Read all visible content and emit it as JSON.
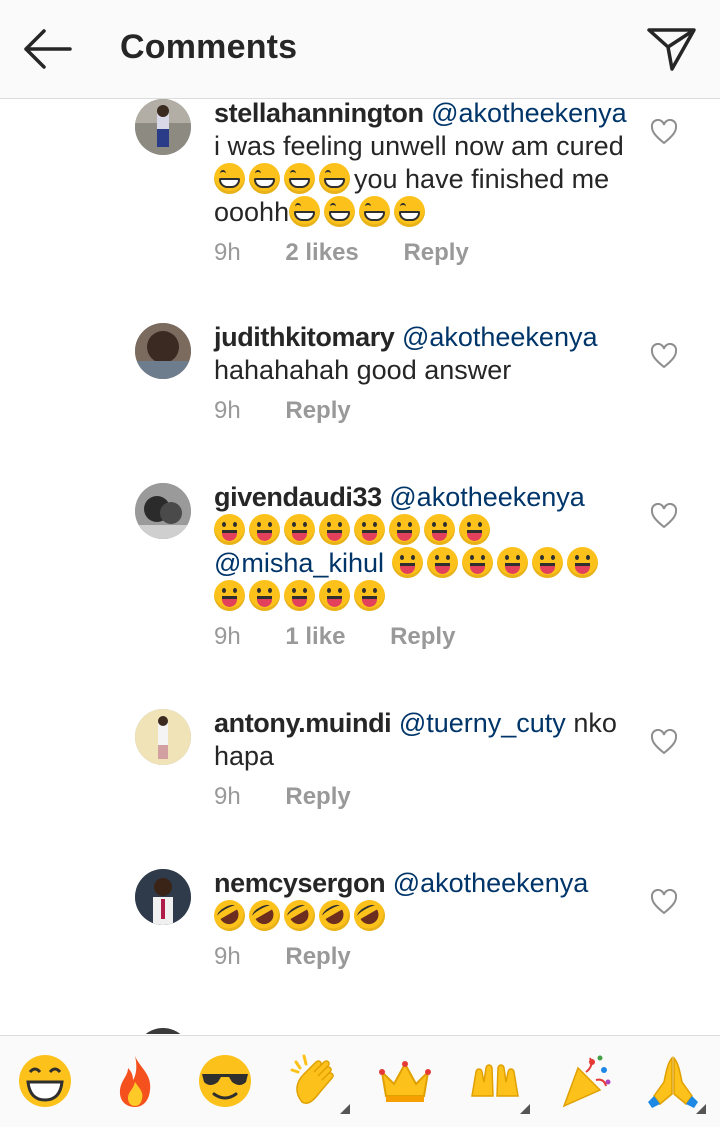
{
  "header": {
    "title": "Comments",
    "back_icon": "arrow-left-icon",
    "send_icon": "paper-plane-icon"
  },
  "comments": [
    {
      "username": "stellahannington",
      "mention": "@akotheekenya",
      "text": "i was feeling unwell now am cured",
      "text2": "you have finished me ooohh",
      "time": "9h",
      "likes": "2 likes",
      "reply": "Reply"
    },
    {
      "username": "judithkitomary",
      "mention": "@akotheekenya",
      "text": "hahahahah good answer",
      "time": "9h",
      "reply": "Reply"
    },
    {
      "username": "givendaudi33",
      "mention": "@akotheekenya",
      "mention2": "@misha_kihul",
      "time": "9h",
      "likes": "1 like",
      "reply": "Reply"
    },
    {
      "username": "antony.muindi",
      "mention": "@tuerny_cuty",
      "text": "nko hapa",
      "time": "9h",
      "reply": "Reply"
    },
    {
      "username": "nemcysergon",
      "mention": "@akotheekenya",
      "time": "9h",
      "reply": "Reply"
    }
  ],
  "emoji_bar": [
    "grinning-squinting-face",
    "fire",
    "smiling-face-with-sunglasses",
    "clapping-hands",
    "crown",
    "raising-hands",
    "party-popper",
    "folded-hands"
  ],
  "colors": {
    "mention": "#003569",
    "meta": "#999999",
    "text": "#262626",
    "bar_bg": "#fafafa"
  }
}
